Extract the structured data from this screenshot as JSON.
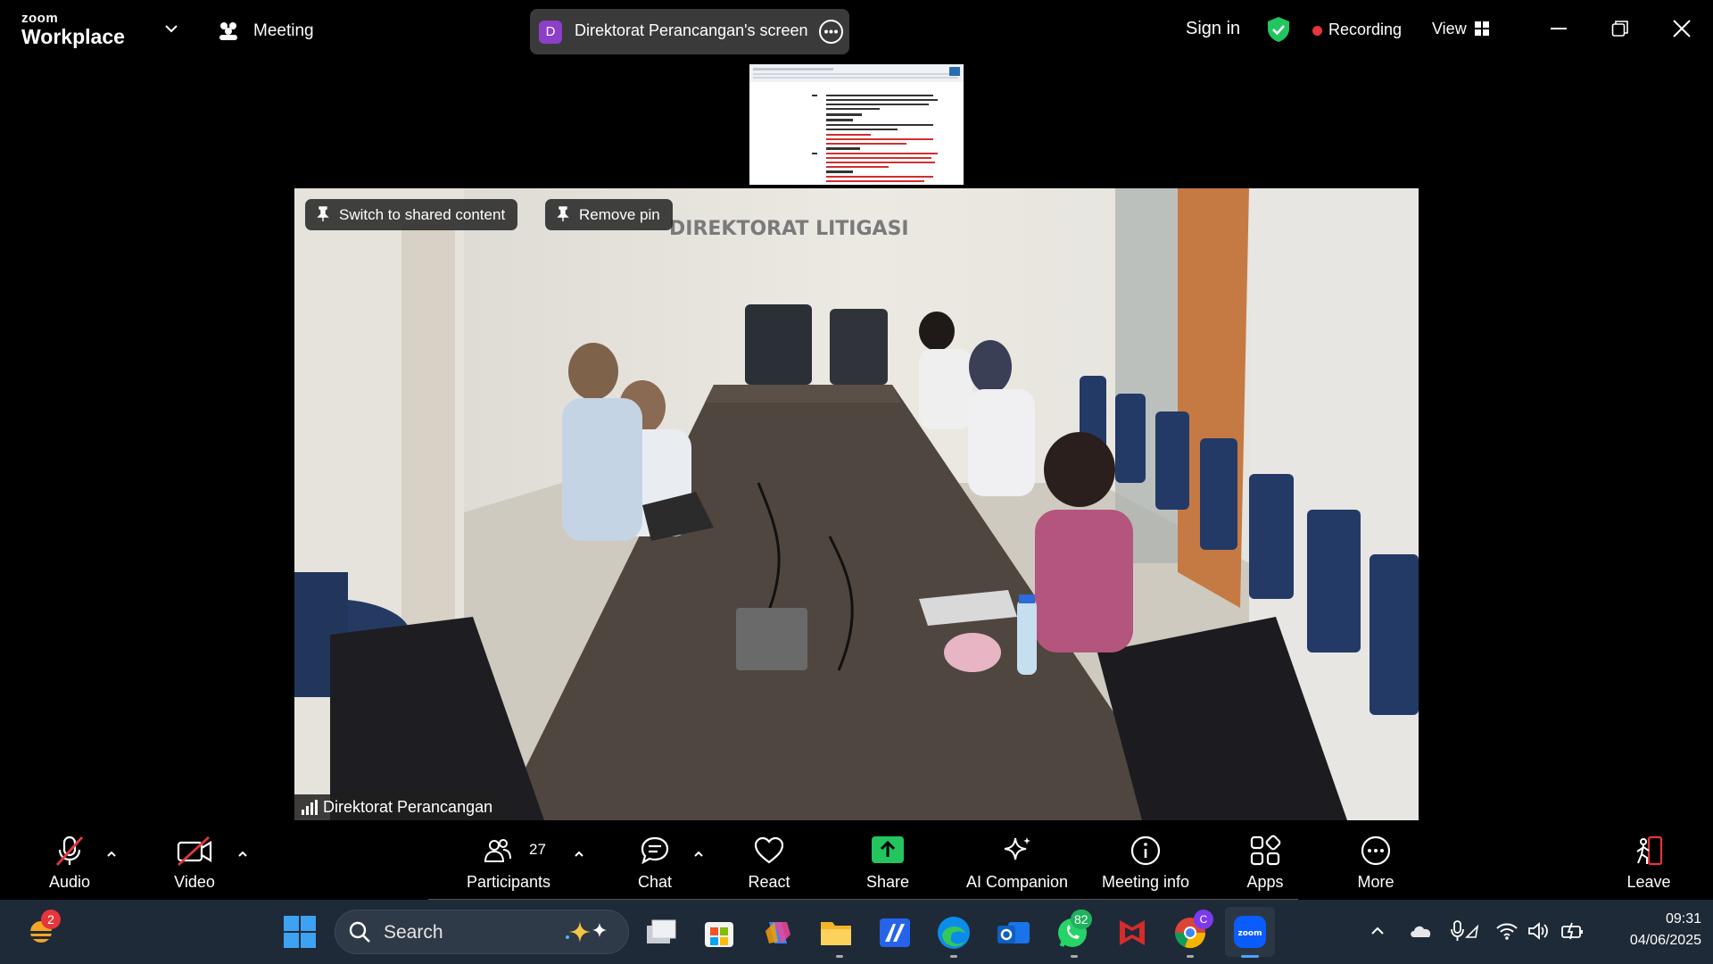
{
  "titlebar": {
    "logo_small": "zoom",
    "logo_big": "Workplace",
    "meeting_label": "Meeting",
    "screen_avatar": "D",
    "screen_label": "Direktorat Perancangan's screen",
    "signin": "Sign in",
    "recording": "Recording",
    "view": "View"
  },
  "video": {
    "switch_label": "Switch to shared content",
    "remove_pin_label": "Remove pin",
    "participant_name": "Direktorat Perancangan",
    "wall_sign": "DIREKTORAT LITIGASI"
  },
  "toolbar": {
    "audio": "Audio",
    "video": "Video",
    "participants": "Participants",
    "participants_count": "27",
    "chat": "Chat",
    "react": "React",
    "share": "Share",
    "ai_companion": "AI Companion",
    "meeting_info": "Meeting info",
    "apps": "Apps",
    "more": "More",
    "leave": "Leave"
  },
  "taskbar": {
    "search": "Search",
    "weather_badge": "2",
    "whatsapp_badge": "82",
    "chrome_badge": "C",
    "time": "09:31",
    "date": "04/06/2025"
  },
  "colors": {
    "recording_dot": "#e5363b",
    "shield": "#22c55e",
    "share_button": "#22c55e",
    "leave_icon": "#e5363b",
    "screen_avatar": "#8c3fc9",
    "taskbar": "#1f2a38"
  }
}
